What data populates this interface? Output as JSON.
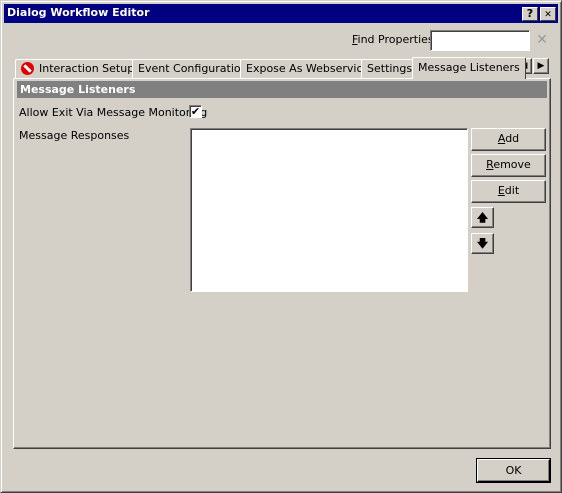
{
  "window": {
    "title": "Dialog Workflow Editor"
  },
  "caption_buttons": {
    "help": "?",
    "close": "✕"
  },
  "find": {
    "label_prefix": "",
    "label_accel": "F",
    "label_rest": "ind Properties",
    "value": "",
    "clear_glyph": "✕"
  },
  "tabs": [
    {
      "label": "Interaction Setup",
      "icon": "no-entry-icon"
    },
    {
      "label": "Event Configuration"
    },
    {
      "label": "Expose As Webservice"
    },
    {
      "label": "Settings"
    },
    {
      "label": "Message Listeners",
      "active": true
    }
  ],
  "tab_scroll": {
    "left": "◀",
    "right": "▶"
  },
  "panel": {
    "header": "Message Listeners",
    "allow_exit_label": "Allow Exit Via Message Monitoring",
    "allow_exit_checked": true,
    "check_glyph": "✔",
    "responses_label": "Message Responses",
    "responses_items": []
  },
  "buttons": {
    "add_accel": "A",
    "add_rest": "dd",
    "remove_accel": "R",
    "remove_rest": "emove",
    "edit_accel": "E",
    "edit_rest": "dit",
    "up_glyph": "🡅",
    "down_glyph": "🡇"
  },
  "ok_label": "OK"
}
